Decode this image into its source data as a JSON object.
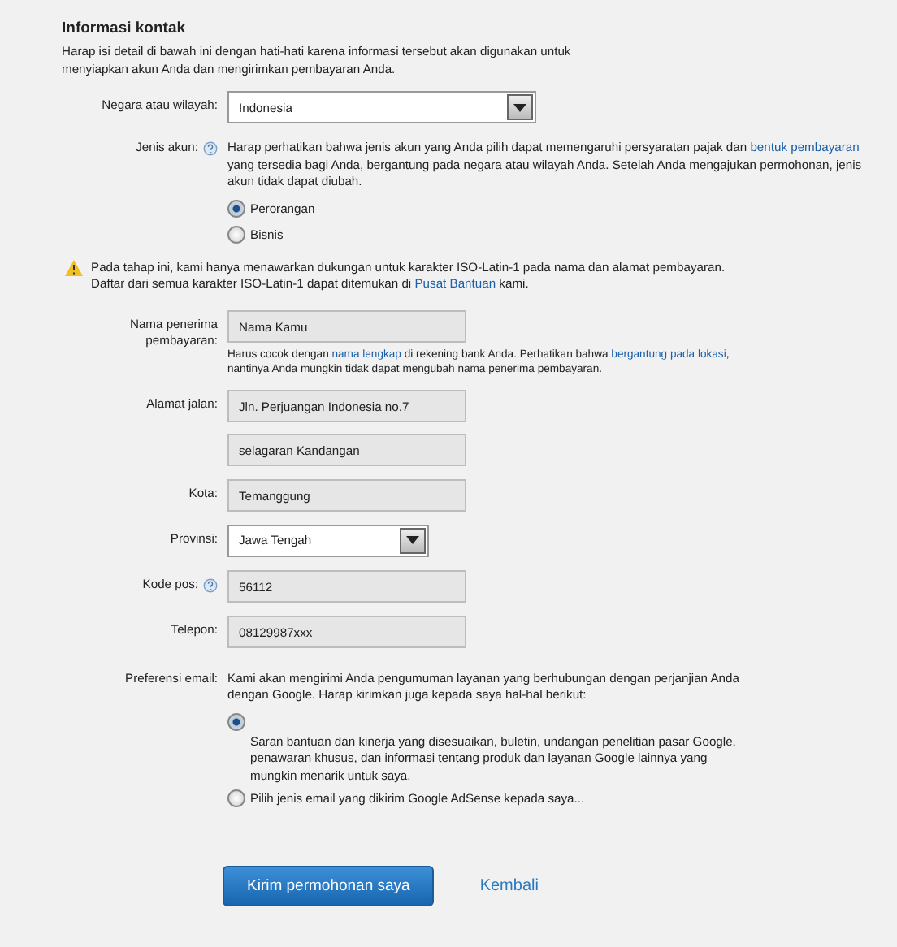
{
  "title": "Informasi kontak",
  "intro": "Harap isi detail di bawah ini dengan hati-hati karena informasi tersebut akan digunakan untuk menyiapkan akun Anda dan mengirimkan pembayaran Anda.",
  "country": {
    "label": "Negara atau wilayah:",
    "value": "Indonesia"
  },
  "account_type": {
    "label": "Jenis akun:",
    "help": true,
    "note": [
      {
        "text": "Harap perhatikan bahwa jenis akun yang Anda pilih dapat memengaruhi persyaratan pajak dan ",
        "link": false
      },
      {
        "text": "bentuk pembayaran",
        "link": true
      },
      {
        "text": " yang tersedia bagi Anda, bergantung pada negara atau wilayah Anda. Setelah Anda mengajukan permohonan, jenis akun tidak dapat diubah.",
        "link": false
      }
    ],
    "options": [
      {
        "label": "Perorangan",
        "selected": true
      },
      {
        "label": "Bisnis",
        "selected": false
      }
    ]
  },
  "warning": [
    {
      "text": "Pada tahap ini, kami hanya menawarkan dukungan untuk karakter ISO-Latin-1 pada nama dan alamat pembayaran. Daftar dari semua karakter ISO-Latin-1 dapat ditemukan di ",
      "link": false
    },
    {
      "text": "Pusat Bantuan",
      "link": true
    },
    {
      "text": " kami.",
      "link": false
    }
  ],
  "fields": [
    {
      "kind": "text",
      "label": "Nama penerima pembayaran:",
      "value": "Nama Kamu",
      "hint": [
        {
          "text": "Harus cocok dengan ",
          "link": false
        },
        {
          "text": "nama lengkap",
          "link": true
        },
        {
          "text": " di rekening bank Anda. Perhatikan bahwa ",
          "link": false
        },
        {
          "text": "bergantung pada lokasi",
          "link": true
        },
        {
          "text": ", nantinya Anda mungkin tidak dapat mengubah nama penerima pembayaran.",
          "link": false
        }
      ]
    },
    {
      "kind": "text",
      "label": "Alamat jalan:",
      "value": "Jln. Perjuangan Indonesia no.7"
    },
    {
      "kind": "text",
      "value": "selagaran Kandangan"
    },
    {
      "kind": "text",
      "label": "Kota:",
      "value": "Temanggung"
    },
    {
      "kind": "select",
      "label": "Provinsi:",
      "value": "Jawa Tengah"
    },
    {
      "kind": "text",
      "label": "Kode pos:",
      "value": "56112",
      "help": true
    },
    {
      "kind": "text",
      "label": "Telepon:",
      "value": "08129987xxx"
    }
  ],
  "email_pref": {
    "label": "Preferensi email:",
    "intro": "Kami akan mengirimi Anda pengumuman layanan yang berhubungan dengan perjanjian Anda dengan Google. Harap kirimkan juga kepada saya hal-hal berikut:",
    "options": [
      {
        "label": "Saran bantuan dan kinerja yang disesuaikan, buletin, undangan penelitian pasar Google, penawaran khusus, dan informasi tentang produk dan layanan Google lainnya yang mungkin menarik untuk saya.",
        "selected": true,
        "kind": "below"
      },
      {
        "label": "Pilih jenis email yang dikirim Google AdSense kepada saya...",
        "selected": false,
        "kind": "inline"
      }
    ]
  },
  "submit": "Kirim permohonan saya",
  "back": "Kembali"
}
